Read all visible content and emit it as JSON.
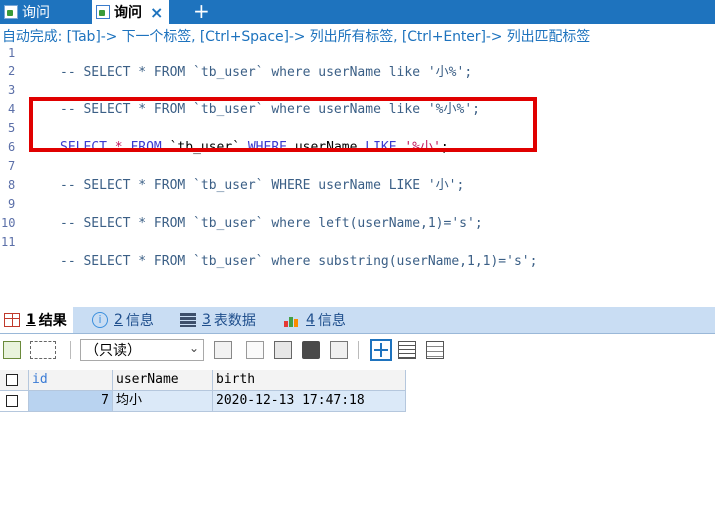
{
  "tabs": [
    {
      "label": "询问"
    },
    {
      "label": "询问",
      "close": "×"
    }
  ],
  "tab_add": "+",
  "hint": "自动完成: [Tab]-> 下一个标签, [Ctrl+Space]-> 列出所有标签, [Ctrl+Enter]-> 列出匹配标签",
  "editor": {
    "line_numbers": [
      "1",
      "2",
      "3",
      "4",
      "5",
      "6",
      "7",
      "8",
      "9",
      "10",
      "11"
    ],
    "lines": {
      "l1": {
        "pre": "-- SELECT * FROM `tb_user` where userName like ",
        "str": "'小%'",
        "post": ";"
      },
      "l3": {
        "pre": "-- SELECT * FROM `tb_user` where userName like ",
        "str": "'%小%'",
        "post": ";"
      },
      "l5": {
        "kw1": "SELECT",
        "op": " * ",
        "kw2": "FROM",
        "tbl": " `tb_user` ",
        "kw3": "WHERE",
        "col": " userName ",
        "kw4": "LIKE",
        "str": " '%小'",
        "post": ";"
      },
      "l7": {
        "pre": "-- SELECT * FROM `tb_user` WHERE userName LIKE ",
        "str": "'小'",
        "post": ";"
      },
      "l9": {
        "pre": "-- SELECT * FROM `tb_user` where left(userName,1)=",
        "str": "'s'",
        "post": ";"
      },
      "l11": {
        "pre": "-- SELECT * FROM `tb_user` where substring(userName,1,1)=",
        "str": "'s'",
        "post": ";"
      }
    }
  },
  "result_tabs": [
    {
      "num": "1",
      "label": "结果"
    },
    {
      "num": "2",
      "label": "信息"
    },
    {
      "num": "3",
      "label": "表数据"
    },
    {
      "num": "4",
      "label": "信息"
    }
  ],
  "toolbar": {
    "mode": "（只读）"
  },
  "grid": {
    "columns": [
      "id",
      "userName",
      "birth"
    ],
    "rows": [
      {
        "id": "7",
        "userName": "均小",
        "birth": "2020-12-13 17:47:18"
      }
    ]
  },
  "colors": {
    "accent": "#1e73be",
    "highlight_border": "#e00000"
  }
}
